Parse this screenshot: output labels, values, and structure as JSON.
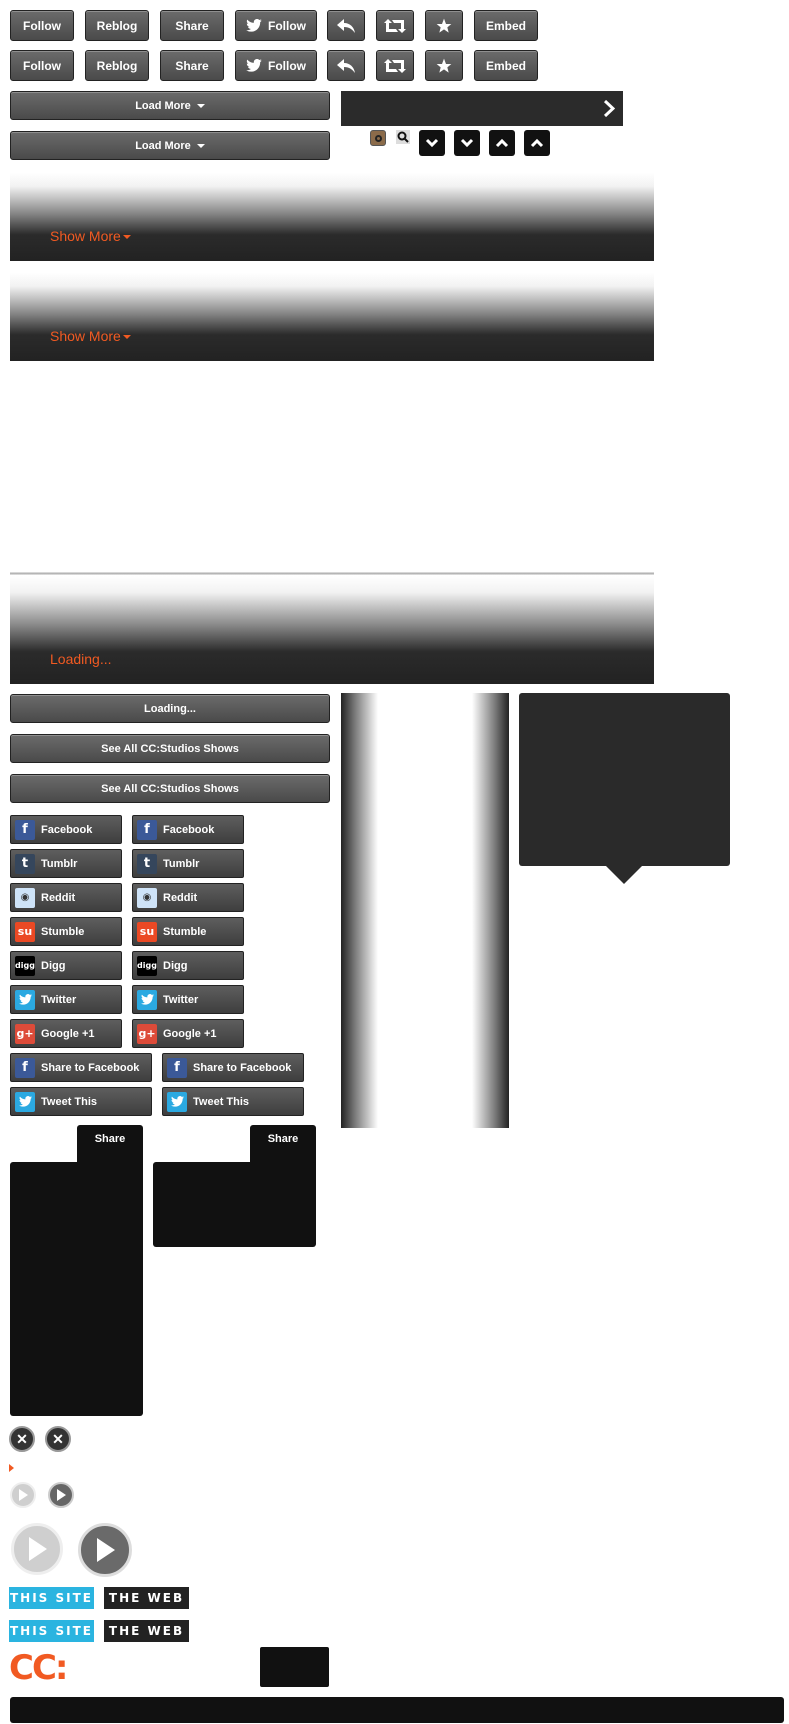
{
  "toolbar": {
    "follow": "Follow",
    "reblog": "Reblog",
    "share": "Share",
    "twitter_follow": "Follow",
    "embed": "Embed"
  },
  "load_more": "Load More",
  "show_more": "Show More",
  "loading": "Loading...",
  "see_all": "See All CC:Studios Shows",
  "social": {
    "facebook": "Facebook",
    "tumblr": "Tumblr",
    "reddit": "Reddit",
    "stumble": "Stumble",
    "digg": "Digg",
    "twitter": "Twitter",
    "google": "Google +1",
    "share_facebook": "Share to Facebook",
    "tweet_this": "Tweet This"
  },
  "share_panel": "Share",
  "search_scope": {
    "this_site": "THIS SITE",
    "the_web": "THE WEB"
  },
  "logo": "CC:",
  "colors": {
    "orange": "#f15a22",
    "this_site_blue": "#2ab4e0",
    "dark": "#222222"
  }
}
